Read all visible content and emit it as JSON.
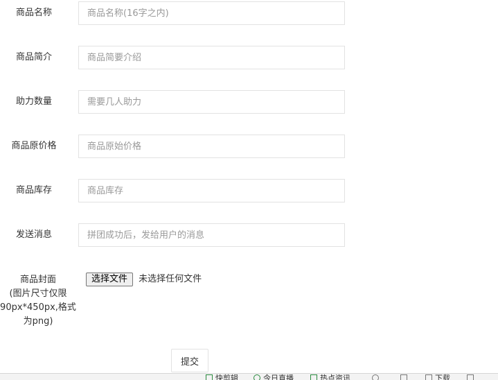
{
  "form": {
    "fields": [
      {
        "label": "商品名称",
        "placeholder": "商品名称(16字之内)"
      },
      {
        "label": "商品简介",
        "placeholder": "商品简要介绍"
      },
      {
        "label": "助力数量",
        "placeholder": "需要几人助力"
      },
      {
        "label": "商品原价格",
        "placeholder": "商品原始价格"
      },
      {
        "label": "商品库存",
        "placeholder": "商品库存"
      },
      {
        "label": "发送消息",
        "placeholder": "拼团成功后，发给用户的消息"
      }
    ],
    "cover": {
      "label_lines": [
        "商品封面",
        "(图片尺寸仅限",
        "90px*450px,格式",
        "为png)"
      ],
      "file_button": "选择文件",
      "file_status": "未选择任何文件"
    },
    "submit_label": "提交"
  },
  "statusbar": {
    "items": [
      {
        "label": "快剪辑",
        "icon": "scissors-icon"
      },
      {
        "label": "今日直播",
        "icon": "live-icon"
      },
      {
        "label": "热点资讯",
        "icon": "news-icon"
      },
      {
        "label": "",
        "icon": "speed-icon"
      },
      {
        "label": "",
        "icon": "sound-icon"
      },
      {
        "label": "下载",
        "icon": "download-icon"
      },
      {
        "label": "",
        "icon": "window-icon"
      }
    ]
  }
}
